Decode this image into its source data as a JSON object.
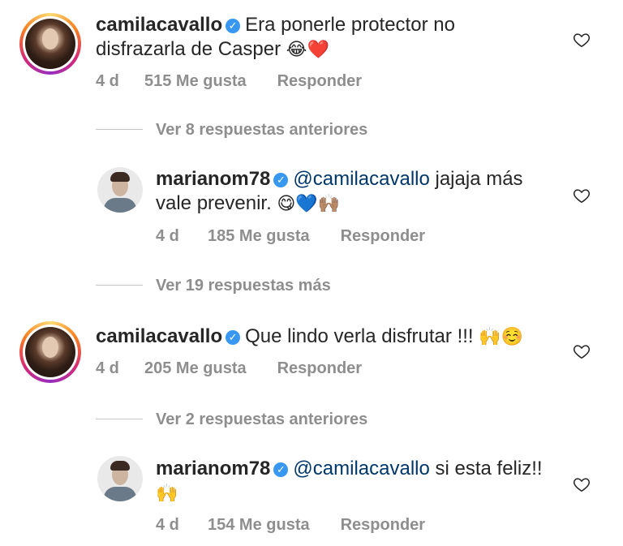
{
  "comments": [
    {
      "username": "camilacavallo",
      "text": "Era ponerle protector no disfrazarla de Casper",
      "emojis": "😂❤️",
      "age": "4 d",
      "likes": "515 Me gusta",
      "reply": "Responder"
    },
    {
      "username": "marianom78",
      "mention": "@camilacavallo",
      "text": "jajaja más vale prevenir.",
      "emojis": "😋💙🙌🏽",
      "age": "4 d",
      "likes": "185 Me gusta",
      "reply": "Responder"
    },
    {
      "username": "camilacavallo",
      "text": "Que lindo verla disfrutar !!!",
      "emojis": "🙌☺️",
      "age": "4 d",
      "likes": "205 Me gusta",
      "reply": "Responder"
    },
    {
      "username": "marianom78",
      "mention": "@camilacavallo",
      "text": "si esta feliz!!",
      "emojis": "🙌",
      "age": "4 d",
      "likes": "154 Me gusta",
      "reply": "Responder"
    }
  ],
  "threads": [
    "Ver 8 respuestas anteriores",
    "Ver 19 respuestas más",
    "Ver 2 respuestas anteriores"
  ],
  "icons": {
    "verified": "verified-badge-icon",
    "like": "heart-outline-icon"
  },
  "colors": {
    "text": "#262626",
    "meta": "#8e8e8e",
    "mention": "#00376b",
    "verified": "#3897f0"
  }
}
